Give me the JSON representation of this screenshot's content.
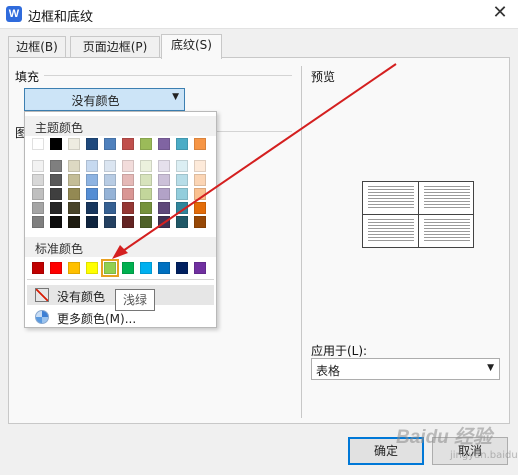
{
  "window": {
    "title": "边框和底纹",
    "app_icon_glyph": "W"
  },
  "tabs": [
    {
      "label": "边框(B)",
      "active": false
    },
    {
      "label": "页面边框(P)",
      "active": false
    },
    {
      "label": "底纹(S)",
      "active": true
    }
  ],
  "fill": {
    "group_label": "填充",
    "selected": "没有颜色"
  },
  "pattern": {
    "group_label_partial": "图"
  },
  "preview": {
    "label": "预览"
  },
  "apply_to": {
    "label": "应用于(L):",
    "value": "表格"
  },
  "buttons": {
    "ok": "确定",
    "cancel": "取消"
  },
  "color_popup": {
    "theme_title": "主题颜色",
    "theme_rows": [
      [
        "#FFFFFF",
        "#000000",
        "#EEECE1",
        "#1F497D",
        "#4F81BD",
        "#C0504D",
        "#9BBB59",
        "#8064A2",
        "#4BACC6",
        "#F79646"
      ],
      [
        "#F2F2F2",
        "#7F7F7F",
        "#DDD9C3",
        "#C6D9F0",
        "#DBE5F1",
        "#F2DCDB",
        "#EBF1DD",
        "#E5E0EC",
        "#DBEEF3",
        "#FDEADA"
      ],
      [
        "#D8D8D8",
        "#595959",
        "#C4BD97",
        "#8DB3E2",
        "#B8CCE4",
        "#E5B9B7",
        "#D7E3BC",
        "#CCC1D9",
        "#B7DDE8",
        "#FBD5B5"
      ],
      [
        "#BFBFBF",
        "#3F3F3F",
        "#938953",
        "#548DD4",
        "#95B3D7",
        "#D99694",
        "#C3D69B",
        "#B2A2C7",
        "#92CDDC",
        "#FAC08F"
      ],
      [
        "#A5A5A5",
        "#262626",
        "#494429",
        "#17365D",
        "#366092",
        "#953734",
        "#76923C",
        "#5F497A",
        "#31859B",
        "#E36C09"
      ],
      [
        "#7F7F7F",
        "#0C0C0C",
        "#1D1B10",
        "#0F243E",
        "#244061",
        "#632423",
        "#4F6128",
        "#3F3151",
        "#205867",
        "#974806"
      ]
    ],
    "standard_title": "标准颜色",
    "standard_colors": [
      "#C00000",
      "#FF0000",
      "#FFC000",
      "#FFFF00",
      "#92D050",
      "#00B050",
      "#00B0F0",
      "#0070C0",
      "#002060",
      "#7030A0"
    ],
    "selected_standard_index": 4,
    "no_color_label": "没有颜色",
    "more_colors_label": "更多颜色(M)...",
    "tooltip": "浅绿"
  },
  "annotation": {
    "arrow_color": "#D42020"
  },
  "watermark": {
    "text": "Baidu 经验",
    "sub": "jingyan.baidu.com"
  }
}
